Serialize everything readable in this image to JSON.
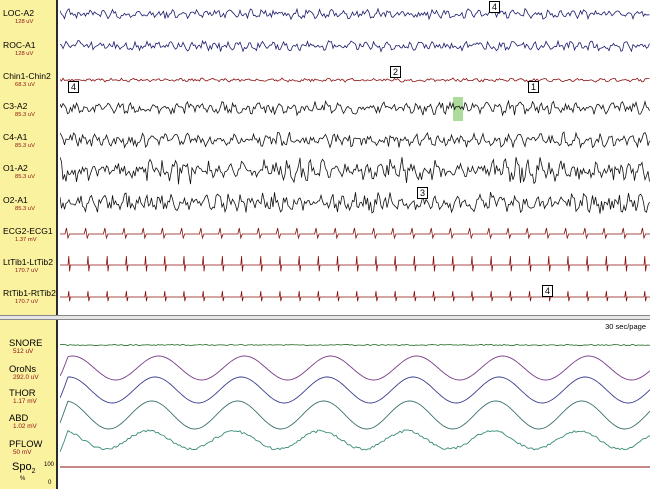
{
  "eeg_channels": [
    {
      "name": "LOC-A2",
      "scale": "128 uV",
      "color": "#1c1c6e",
      "type": "eeg"
    },
    {
      "name": "ROC-A1",
      "scale": "128 uV",
      "color": "#1c1c6e",
      "type": "eeg"
    },
    {
      "name": "Chin1-Chin2",
      "scale": "68.3 uV",
      "color": "#8a1010",
      "type": "emg"
    },
    {
      "name": "C3-A2",
      "scale": "85.3 uV",
      "color": "#111111",
      "type": "eeg"
    },
    {
      "name": "C4-A1",
      "scale": "85.3 uV",
      "color": "#111111",
      "type": "eeg"
    },
    {
      "name": "O1-A2",
      "scale": "85.3 uV",
      "color": "#111111",
      "type": "eeg"
    },
    {
      "name": "O2-A1",
      "scale": "85.3 uV",
      "color": "#111111",
      "type": "eeg"
    },
    {
      "name": "ECG2-ECG1",
      "scale": "1.37 mV",
      "color": "#8a1010",
      "type": "ecg"
    },
    {
      "name": "LtTib1-LtTib2",
      "scale": "170.7 uV",
      "color": "#8a1010",
      "type": "tib"
    },
    {
      "name": "RtTib1-RtTib2",
      "scale": "170.7 uV",
      "color": "#8a1010",
      "type": "tib"
    }
  ],
  "resp_channels": [
    {
      "name": "SNORE",
      "scale": "512 uV",
      "color": "#3c7a3c"
    },
    {
      "name": "OroNs",
      "scale": "292.0 uV",
      "color": "#7a3c8a"
    },
    {
      "name": "THOR",
      "scale": "1.17 mV",
      "color": "#3a3f8f"
    },
    {
      "name": "ABD",
      "scale": "1.02 mV",
      "color": "#3c6e6e"
    },
    {
      "name": "PFLOW",
      "scale": "50 mV",
      "color": "#3a8a7a"
    }
  ],
  "spo2": {
    "label": "Spo",
    "sub": "2",
    "unit": "%",
    "max": "100",
    "min": "0",
    "color": "#8a1010"
  },
  "page_speed": "30 sec/page",
  "markers": [
    "4",
    "2",
    "4",
    "1",
    "3",
    "4"
  ],
  "colors": {
    "label_bg": "#fbf2a0",
    "label_scale": "#8a1010",
    "highlight": "#9ed58a"
  }
}
